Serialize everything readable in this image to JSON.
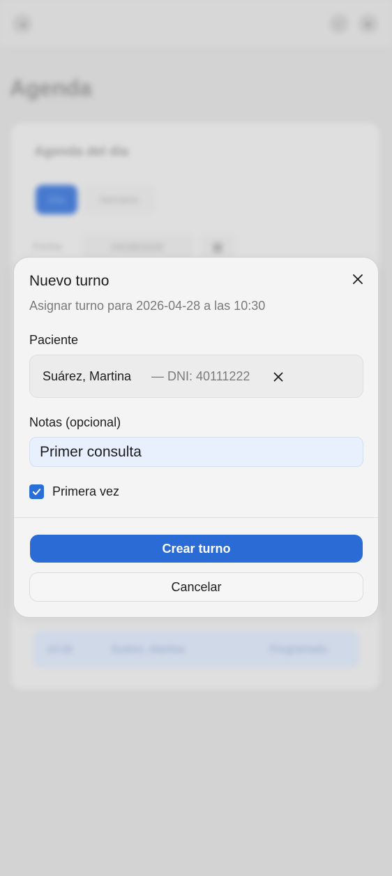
{
  "background": {
    "page_title": "Agenda",
    "card_title": "Agenda del día",
    "view_toggle": {
      "day": "Día",
      "week": "Semana"
    },
    "date_label": "Fecha",
    "date_value": "04/28/2026",
    "appointment": {
      "time": "10:30",
      "patient": "Suárez, Martina",
      "status": "Programado"
    }
  },
  "modal": {
    "title": "Nuevo turno",
    "subtitle": "Asignar turno para 2026-04-28 a las 10:30",
    "patient_label": "Paciente",
    "patient_name": "Suárez, Martina",
    "patient_dni": "— DNI: 40111222",
    "notes_label": "Notas (opcional)",
    "notes_value": "Primer consulta",
    "first_time_label": "Primera vez",
    "first_time_checked": true,
    "create_label": "Crear turno",
    "cancel_label": "Cancelar"
  },
  "colors": {
    "primary": "#2a6bd6",
    "notes_bg": "#e8f0fd"
  },
  "icons": {
    "top_left": "circle-arrow-left-icon",
    "top_right_1": "search-icon",
    "top_right_2": "user-icon",
    "close": "close-icon",
    "clear": "close-icon",
    "calendar": "calendar-icon",
    "check": "check-icon"
  }
}
